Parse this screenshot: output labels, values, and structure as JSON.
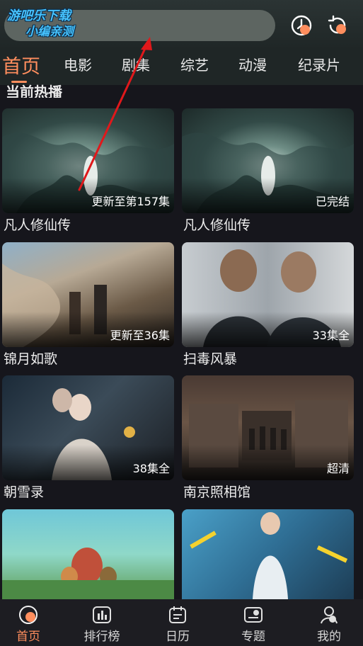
{
  "header": {
    "watermark_line1": "游吧乐下载",
    "watermark_line2": "小编亲测"
  },
  "tabs": [
    {
      "label": "首页",
      "active": true
    },
    {
      "label": "电影",
      "active": false
    },
    {
      "label": "剧集",
      "active": false
    },
    {
      "label": "综艺",
      "active": false
    },
    {
      "label": "动漫",
      "active": false
    },
    {
      "label": "纪录片",
      "active": false
    }
  ],
  "section": {
    "title": "当前热播"
  },
  "cards": [
    {
      "title": "凡人修仙传",
      "badge": "更新至第157集"
    },
    {
      "title": "凡人修仙传",
      "badge": "已完结"
    },
    {
      "title": "锦月如歌",
      "badge": "更新至36集"
    },
    {
      "title": "扫毒风暴",
      "badge": "33集全"
    },
    {
      "title": "朝雪录",
      "badge": "38集全"
    },
    {
      "title": "南京照相馆",
      "badge": "超清"
    },
    {
      "title": "",
      "badge": ""
    },
    {
      "title": "",
      "badge": ""
    }
  ],
  "bottom_nav": [
    {
      "label": "首页",
      "icon": "home-icon",
      "active": true
    },
    {
      "label": "排行榜",
      "icon": "ranking-icon",
      "active": false
    },
    {
      "label": "日历",
      "icon": "calendar-icon",
      "active": false
    },
    {
      "label": "专题",
      "icon": "topic-icon",
      "active": false
    },
    {
      "label": "我的",
      "icon": "profile-icon",
      "active": false
    }
  ],
  "colors": {
    "accent": "#ff8e5e",
    "background": "#16161c",
    "annotation_arrow": "#e0181b",
    "watermark": "#46c3ff"
  }
}
